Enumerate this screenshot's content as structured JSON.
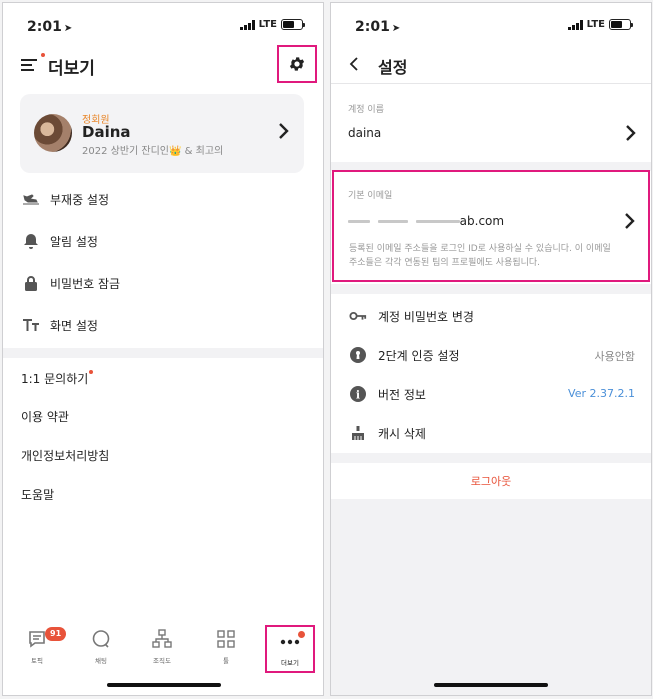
{
  "status": {
    "time": "2:01",
    "network": "LTE"
  },
  "left": {
    "title": "더보기",
    "profile": {
      "nickname": "정회원",
      "name": "Daina",
      "desc": "2022 상반기 잔디인👑 & 최고의"
    },
    "menu": [
      {
        "label": "부재중 설정",
        "icon": "airplane-icon"
      },
      {
        "label": "알림 설정",
        "icon": "bell-icon"
      },
      {
        "label": "비밀번호 잠금",
        "icon": "lock-icon"
      },
      {
        "label": "화면 설정",
        "icon": "text-size-icon"
      }
    ],
    "support": {
      "inquiry": "1:1 문의하기",
      "terms": "이용 약관",
      "privacy": "개인정보처리방침",
      "help": "도움말"
    },
    "tabs": [
      {
        "label": "토픽",
        "badge": "91"
      },
      {
        "label": "채팅"
      },
      {
        "label": "조직도"
      },
      {
        "label": "툴"
      },
      {
        "label": "더보기"
      }
    ]
  },
  "right": {
    "title": "설정",
    "account_name_label": "계정 이름",
    "account_name": "daina",
    "email_label": "기본 이메일",
    "email_visible_suffix": "ab.com",
    "email_help": "등록된 이메일 주소들을 로그인 ID로 사용하실 수 있습니다. 이 이메일 주소들은 각각 연동된 팀의 프로필에도 사용됩니다.",
    "items": [
      {
        "label": "계정 비밀번호 변경",
        "value": ""
      },
      {
        "label": "2단계 인증 설정",
        "value": "사용안함"
      },
      {
        "label": "버전 정보",
        "value": "Ver 2.37.2.1"
      },
      {
        "label": "캐시 삭제",
        "value": ""
      }
    ],
    "logout": "로그아웃"
  },
  "colors": {
    "accent_highlight": "#e0197d",
    "badge_red": "#e8533a",
    "link_blue": "#4a8fd8",
    "nickname_orange": "#e8862a"
  }
}
